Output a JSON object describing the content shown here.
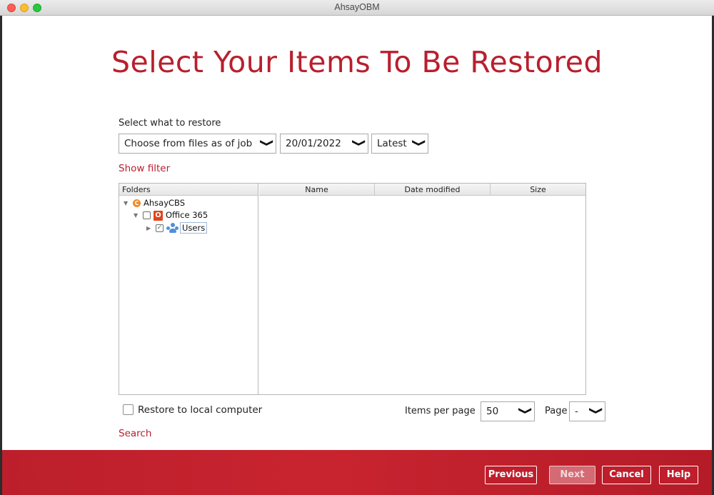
{
  "window": {
    "title": "AhsayOBM"
  },
  "page": {
    "title": "Select Your Items To Be Restored"
  },
  "restore_source": {
    "label": "Select what to restore",
    "mode_value": "Choose from files as of job",
    "date_value": "20/01/2022",
    "time_value": "Latest"
  },
  "links": {
    "show_filter": "Show filter",
    "search": "Search"
  },
  "table": {
    "folders_header": "Folders",
    "columns": [
      "Name",
      "Date modified",
      "Size"
    ]
  },
  "tree": {
    "root": {
      "label": "AhsayCBS",
      "icon": "ahsaycbs-icon"
    },
    "child": {
      "label": "Office 365",
      "icon": "office365-icon",
      "checked": false
    },
    "grandchild": {
      "label": "Users",
      "icon": "users-icon",
      "checked": true
    }
  },
  "options": {
    "restore_local_label": "Restore to local computer",
    "restore_local_checked": false
  },
  "pagination": {
    "items_per_page_label": "Items per page",
    "items_per_page_value": "50",
    "page_label": "Page",
    "page_value": "-"
  },
  "buttons": {
    "previous": "Previous",
    "next": "Next",
    "cancel": "Cancel",
    "help": "Help"
  },
  "colors": {
    "brand": "#b81f2e",
    "footer": "#c8242f"
  }
}
